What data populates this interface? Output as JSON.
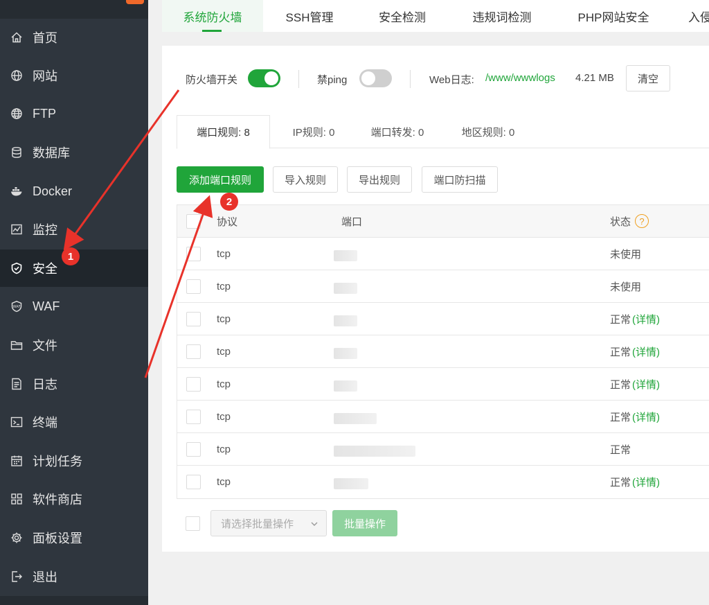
{
  "sidebar": {
    "items": [
      {
        "label": "首页",
        "icon": "home-icon"
      },
      {
        "label": "网站",
        "icon": "globe-icon"
      },
      {
        "label": "FTP",
        "icon": "ftp-globe-icon"
      },
      {
        "label": "数据库",
        "icon": "database-icon"
      },
      {
        "label": "Docker",
        "icon": "docker-whale-icon"
      },
      {
        "label": "监控",
        "icon": "monitor-chart-icon"
      },
      {
        "label": "安全",
        "icon": "shield-check-icon",
        "active": true
      },
      {
        "label": "WAF",
        "icon": "waf-shield-icon"
      },
      {
        "label": "文件",
        "icon": "folder-icon"
      },
      {
        "label": "日志",
        "icon": "log-document-icon"
      },
      {
        "label": "终端",
        "icon": "terminal-icon"
      },
      {
        "label": "计划任务",
        "icon": "calendar-icon"
      },
      {
        "label": "软件商店",
        "icon": "app-grid-icon"
      },
      {
        "label": "面板设置",
        "icon": "gear-icon"
      },
      {
        "label": "退出",
        "icon": "logout-icon"
      }
    ]
  },
  "top_tabs": [
    "系统防火墙",
    "SSH管理",
    "安全检测",
    "违规词检测",
    "PHP网站安全",
    "入侵"
  ],
  "firewall": {
    "switch_label": "防火墙开关",
    "switch_on": true,
    "ping_label": "禁ping",
    "ping_on": false,
    "weblog_label": "Web日志:",
    "weblog_path": "/www/wwwlogs",
    "weblog_size": "4.21 MB",
    "clear_label": "清空"
  },
  "rule_tabs": [
    "端口规则: 8",
    "IP规则: 0",
    "端口转发: 0",
    "地区规则: 0"
  ],
  "actions": {
    "add": "添加端口规则",
    "import": "导入规则",
    "export": "导出规则",
    "scan": "端口防扫描"
  },
  "table": {
    "headers": {
      "protocol": "协议",
      "port": "端口",
      "status": "状态"
    },
    "rows": [
      {
        "protocol": "tcp",
        "status": "未使用",
        "detail": ""
      },
      {
        "protocol": "tcp",
        "status": "未使用",
        "detail": ""
      },
      {
        "protocol": "tcp",
        "status": "正常",
        "detail": "(详情)"
      },
      {
        "protocol": "tcp",
        "status": "正常",
        "detail": "(详情)"
      },
      {
        "protocol": "tcp",
        "status": "正常",
        "detail": "(详情)"
      },
      {
        "protocol": "tcp",
        "status": "正常",
        "detail": "(详情)"
      },
      {
        "protocol": "tcp",
        "status": "正常",
        "detail": ""
      },
      {
        "protocol": "tcp",
        "status": "正常",
        "detail": "(详情)"
      }
    ]
  },
  "batch": {
    "placeholder": "请选择批量操作",
    "button": "批量操作"
  },
  "annotations": {
    "badge1": "1",
    "badge2": "2",
    "color": "#e8322a"
  },
  "colors": {
    "accent": "#20a53a",
    "sidebar_bg": "#2f363e"
  }
}
